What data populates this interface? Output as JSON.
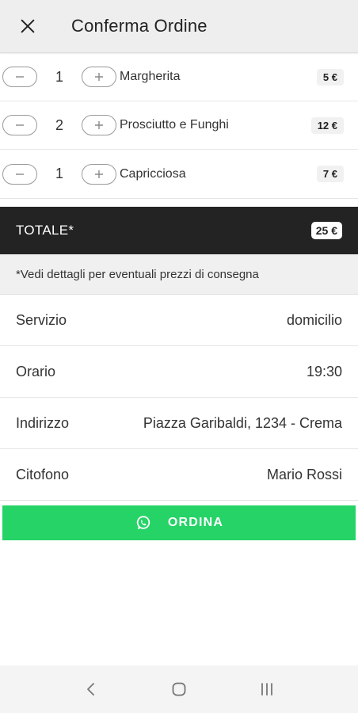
{
  "header": {
    "title": "Conferma Ordine",
    "close_icon": "close-icon"
  },
  "order": {
    "items": [
      {
        "qty": "1",
        "name": "Margherita",
        "price": "5 €"
      },
      {
        "qty": "2",
        "name": "Prosciutto e Funghi",
        "price": "12 €"
      },
      {
        "qty": "1",
        "name": "Capricciosa",
        "price": "7 €"
      }
    ],
    "total_label": "TOTALE*",
    "total_value": "25 €",
    "note": "*Vedi dettagli per eventuali prezzi di consegna"
  },
  "details": [
    {
      "label": "Servizio",
      "value": "domicilio"
    },
    {
      "label": "Orario",
      "value": "19:30"
    },
    {
      "label": "Indirizzo",
      "value": "Piazza Garibaldi, 1234 - Crema"
    },
    {
      "label": "Citofono",
      "value": "Mario Rossi"
    }
  ],
  "action": {
    "order_label": "ORDINA",
    "icon": "whatsapp-icon"
  },
  "colors": {
    "topbar_bg": "#eeeeee",
    "total_bar_bg": "#232323",
    "order_button_bg": "#25d366"
  }
}
